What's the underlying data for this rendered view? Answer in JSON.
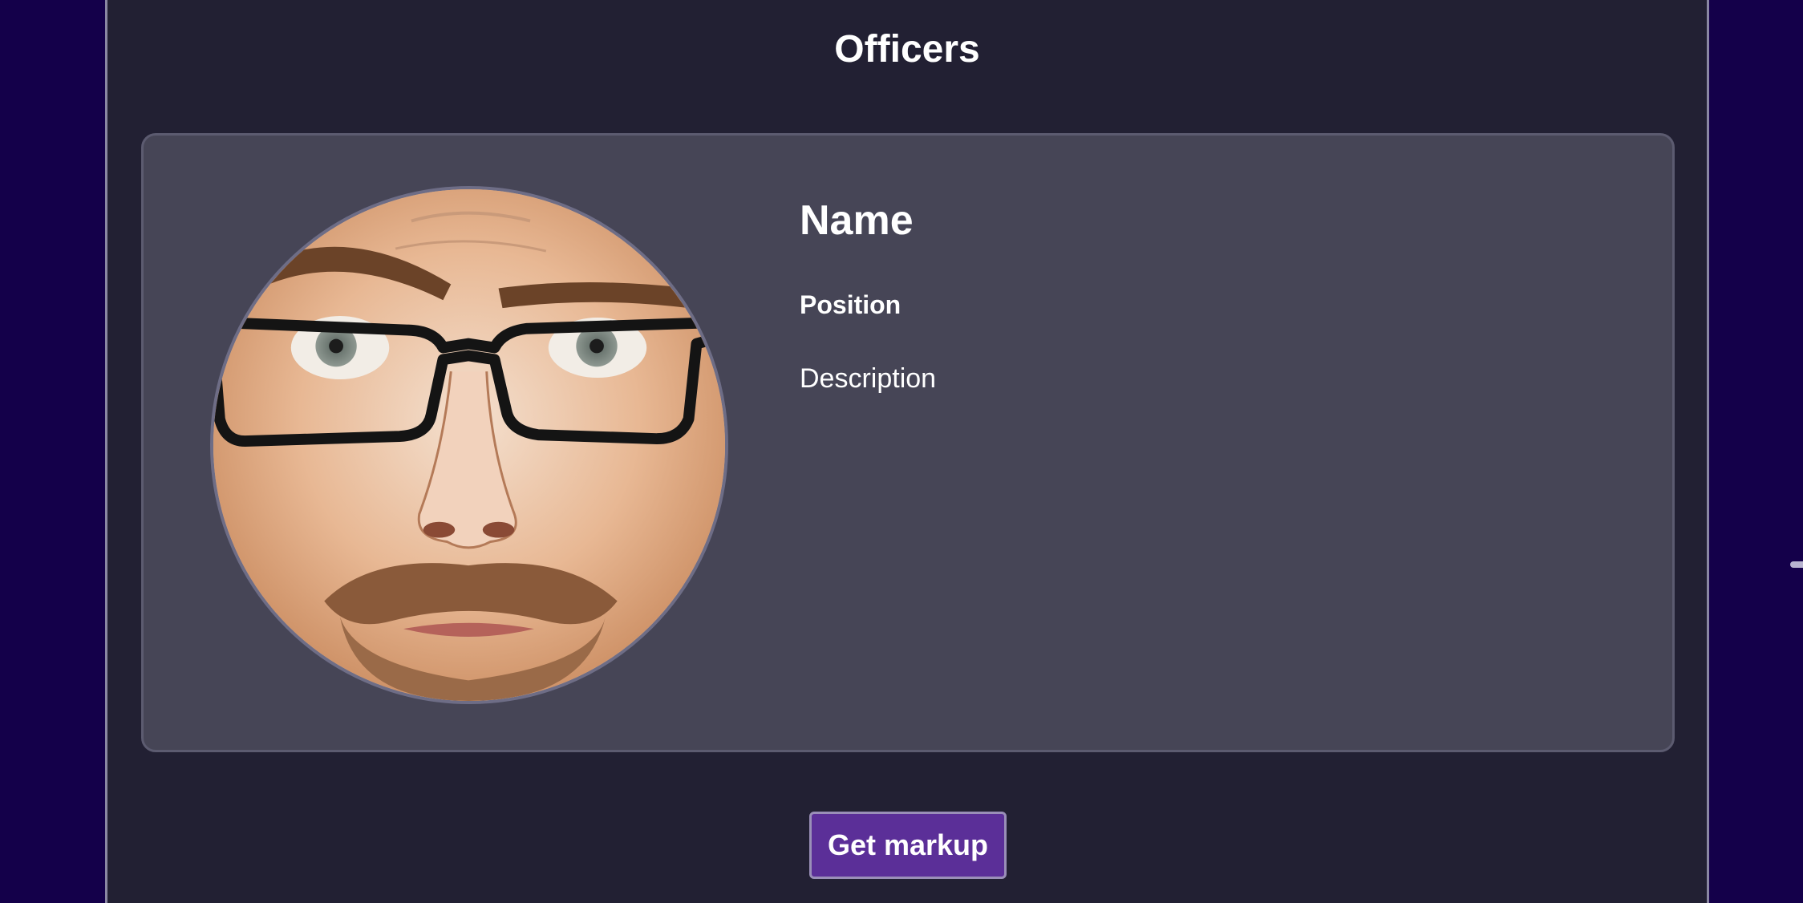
{
  "section": {
    "title": "Officers"
  },
  "officer": {
    "name": "Name",
    "position": "Position",
    "description": "Description",
    "photo_icon": "officer-photo"
  },
  "actions": {
    "get_markup_label": "Get markup"
  },
  "colors": {
    "page_background": "#14004a",
    "panel_background": "#222033",
    "card_background": "#464556",
    "button_background": "#5b2f98",
    "text": "#ffffff"
  }
}
